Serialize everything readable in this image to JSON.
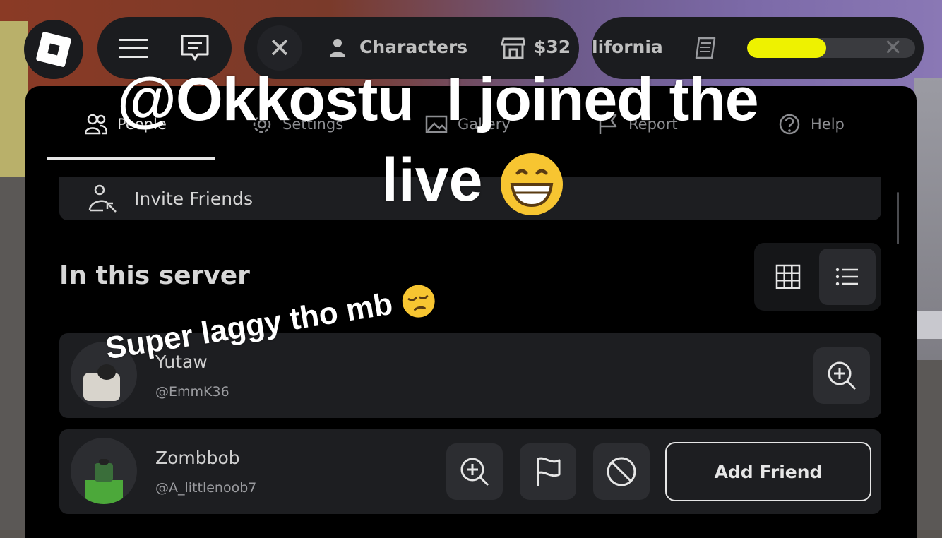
{
  "topbar": {
    "characters_label": "Characters",
    "shop_price": "$32",
    "location_label": "lifornia",
    "progress_fraction": 0.47,
    "accent_color": "#eef200"
  },
  "tabs": [
    {
      "label": "People",
      "icon": "people-icon"
    },
    {
      "label": "Settings",
      "icon": "gear-icon"
    },
    {
      "label": "Gallery",
      "icon": "gallery-icon"
    },
    {
      "label": "Report",
      "icon": "flag-icon"
    },
    {
      "label": "Help",
      "icon": "help-icon"
    }
  ],
  "invite": {
    "label": "Invite Friends"
  },
  "server": {
    "title": "In this server"
  },
  "players": [
    {
      "name": "Yutaw",
      "handle": "@EmmK36"
    },
    {
      "name": "Zombbob",
      "handle": "@A_littlenoob7",
      "add_label": "Add Friend"
    }
  ],
  "overlay": {
    "line1": "@Okkostu  I joined the",
    "line2": "live",
    "line3": "Super laggy tho mb"
  }
}
